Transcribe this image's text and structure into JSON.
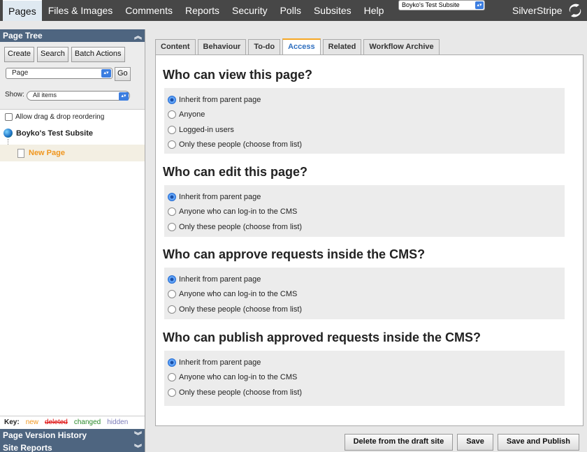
{
  "topnav": {
    "tabs": [
      "Pages",
      "Files & Images",
      "Comments",
      "Reports",
      "Security",
      "Polls",
      "Subsites",
      "Help"
    ],
    "subsite": "Boyko's Test Subsite",
    "brand": "SilverStripe"
  },
  "sidebar": {
    "page_tree_title": "Page Tree",
    "create_label": "Create",
    "search_label": "Search",
    "batch_label": "Batch Actions",
    "page_type": "Page",
    "go_label": "Go",
    "show_label": "Show:",
    "show_value": "All items",
    "drag_label": "Allow drag & drop reordering",
    "tree_root": "Boyko's Test Subsite",
    "tree_child": "New Page",
    "key": {
      "label": "Key:",
      "new": "new",
      "deleted": "deleted",
      "changed": "changed",
      "hidden": "hidden"
    },
    "version_history": "Page Version History",
    "site_reports": "Site Reports"
  },
  "main": {
    "tabs": [
      "Content",
      "Behaviour",
      "To-do",
      "Access",
      "Related",
      "Workflow Archive"
    ],
    "active_tab": "Access",
    "sections": [
      {
        "title": "Who can view this page?",
        "options": [
          "Inherit from parent page",
          "Anyone",
          "Logged-in users",
          "Only these people (choose from list)"
        ],
        "selected": 0
      },
      {
        "title": "Who can edit this page?",
        "options": [
          "Inherit from parent page",
          "Anyone who can log-in to the CMS",
          "Only these people (choose from list)"
        ],
        "selected": 0
      },
      {
        "title": "Who can approve requests inside the CMS?",
        "options": [
          "Inherit from parent page",
          "Anyone who can log-in to the CMS",
          "Only these people (choose from list)"
        ],
        "selected": 0
      },
      {
        "title": "Who can publish approved requests inside the CMS?",
        "options": [
          "Inherit from parent page",
          "Anyone who can log-in to the CMS",
          "Only these people (choose from list)"
        ],
        "selected": 0
      }
    ],
    "buttons": {
      "delete": "Delete from the draft site",
      "save": "Save",
      "save_publish": "Save and Publish"
    }
  },
  "colors": {
    "nav_bg": "#474747",
    "panel_head": "#4e6580",
    "active_tab_text": "#2f6fbf",
    "new_page": "#f0961e"
  }
}
